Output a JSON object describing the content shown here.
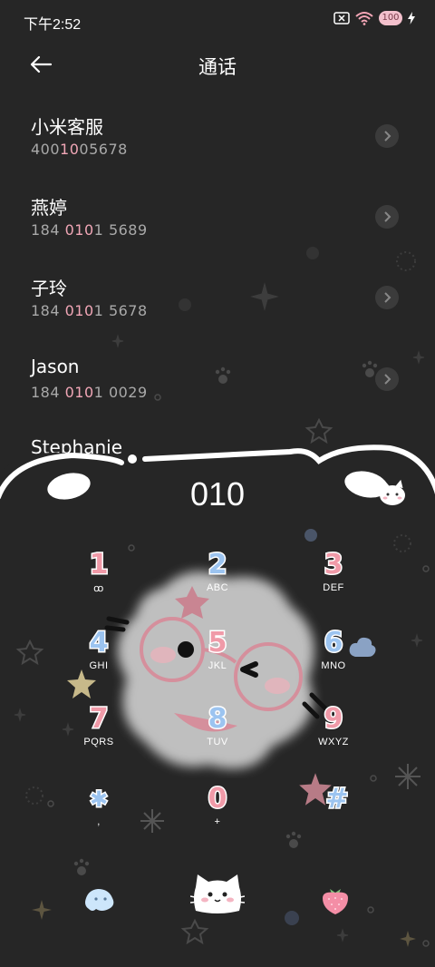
{
  "status": {
    "time": "下午2:52",
    "battery": "100"
  },
  "header": {
    "title": "通话"
  },
  "contacts": [
    {
      "name": "小米客服",
      "num_pre": "400",
      "num_hl": "10",
      "num_post": "05678"
    },
    {
      "name": "燕婷",
      "num_pre": "184 ",
      "num_hl": "010",
      "num_post": "1 5689"
    },
    {
      "name": "子玲",
      "num_pre": "184 ",
      "num_hl": "010",
      "num_post": "1 5678"
    },
    {
      "name": "Jason",
      "num_pre": "184 ",
      "num_hl": "010",
      "num_post": "1 0029"
    },
    {
      "name": "Stephanie",
      "num_pre": "",
      "num_hl": "",
      "num_post": ""
    }
  ],
  "dial": {
    "input": "010",
    "keys": [
      {
        "digit": "1",
        "letters": "ꝏ",
        "color": "#f09aa8"
      },
      {
        "digit": "2",
        "letters": "ABC",
        "color": "#9cc4f0"
      },
      {
        "digit": "3",
        "letters": "DEF",
        "color": "#f09aa8"
      },
      {
        "digit": "4",
        "letters": "GHI",
        "color": "#9cc4f0"
      },
      {
        "digit": "5",
        "letters": "JKL",
        "color": "#f09aa8"
      },
      {
        "digit": "6",
        "letters": "MNO",
        "color": "#9cc4f0"
      },
      {
        "digit": "7",
        "letters": "PQRS",
        "color": "#f09aa8"
      },
      {
        "digit": "8",
        "letters": "TUV",
        "color": "#9cc4f0"
      },
      {
        "digit": "9",
        "letters": "WXYZ",
        "color": "#f09aa8"
      },
      {
        "digit": "✱",
        "letters": ",",
        "color": "#9cc4f0"
      },
      {
        "digit": "0",
        "letters": "+",
        "color": "#f09aa8"
      },
      {
        "digit": "#",
        "letters": "",
        "color": "#9cc4f0"
      }
    ]
  }
}
